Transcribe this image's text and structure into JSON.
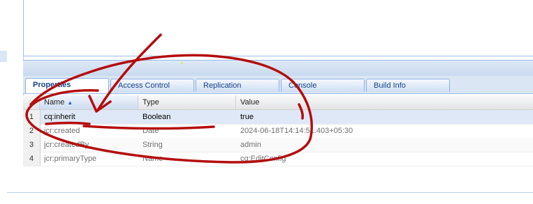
{
  "tabs": [
    {
      "label": "Properties",
      "active": true
    },
    {
      "label": "Access Control",
      "active": false
    },
    {
      "label": "Replication",
      "active": false
    },
    {
      "label": "Console",
      "active": false
    },
    {
      "label": "Build Info",
      "active": false
    }
  ],
  "grid": {
    "columns": {
      "name": "Name",
      "type": "Type",
      "value": "Value"
    },
    "sort_indicator": "▲",
    "rows": [
      {
        "num": "1",
        "name": "cq:inherit",
        "type": "Boolean",
        "value": "true"
      },
      {
        "num": "2",
        "name": "jcr:created",
        "type": "Date",
        "value": "2024-06-18T14:14:51.403+05:30"
      },
      {
        "num": "3",
        "name": "jcr:createdBy",
        "type": "String",
        "value": "admin"
      },
      {
        "num": "4",
        "name": "jcr:primaryType",
        "type": "Name",
        "value": "cq:EditConfig"
      }
    ]
  },
  "colors": {
    "annotation": "#b50d0d",
    "selected_row": "#dfe8f6",
    "tab_text": "#15428b"
  }
}
